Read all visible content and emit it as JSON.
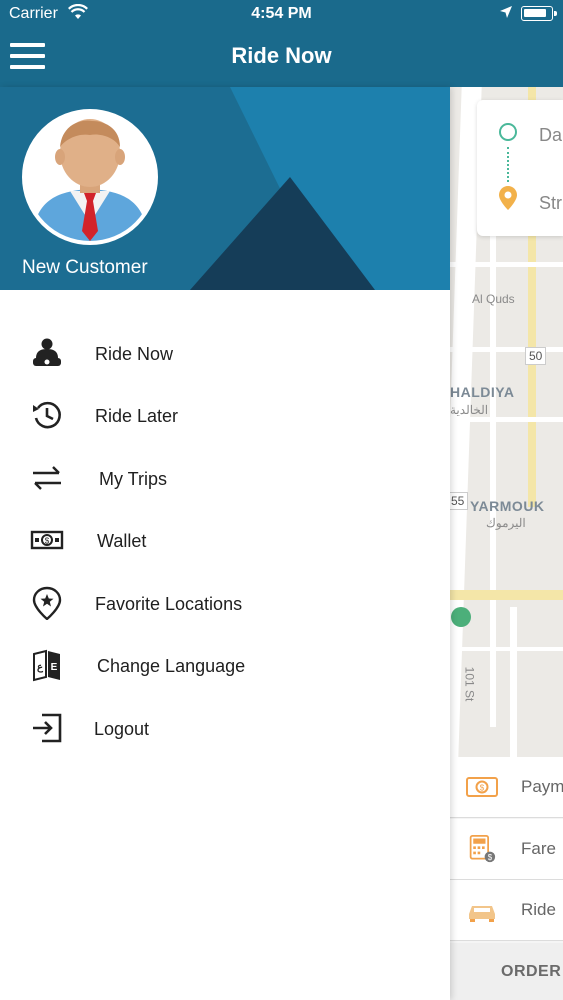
{
  "status_bar": {
    "carrier": "Carrier",
    "time": "4:54 PM"
  },
  "nav": {
    "title": "Ride Now"
  },
  "drawer": {
    "user_name": "New Customer",
    "menu": [
      {
        "label": "Ride Now",
        "icon": "driver-icon"
      },
      {
        "label": "Ride Later",
        "icon": "history-icon"
      },
      {
        "label": "My Trips",
        "icon": "swap-arrows-icon"
      },
      {
        "label": "Wallet",
        "icon": "money-icon"
      },
      {
        "label": "Favorite Locations",
        "icon": "star-pin-icon"
      },
      {
        "label": "Change Language",
        "icon": "language-icon"
      },
      {
        "label": "Logout",
        "icon": "logout-icon"
      }
    ]
  },
  "map": {
    "labels": {
      "al_quds": "Al Quds",
      "khaldiya": "HALDIYA",
      "khaldiya_ar": "الخالدية",
      "yarmouk": "YARMOUK",
      "yarmouk_ar": "اليرموك",
      "road_50": "50",
      "road_55": "55",
      "street_101": "101 St"
    },
    "trip_card": {
      "from": "Da",
      "to": "Str"
    }
  },
  "options": {
    "payment": "Paym",
    "fare": "Fare",
    "ride": "Ride",
    "order": "ORDER"
  },
  "colors": {
    "header": "#1a6a8c",
    "drawer_header": "#1c6d92",
    "accent_green": "#4ab89a",
    "accent_orange": "#f2a14a"
  }
}
